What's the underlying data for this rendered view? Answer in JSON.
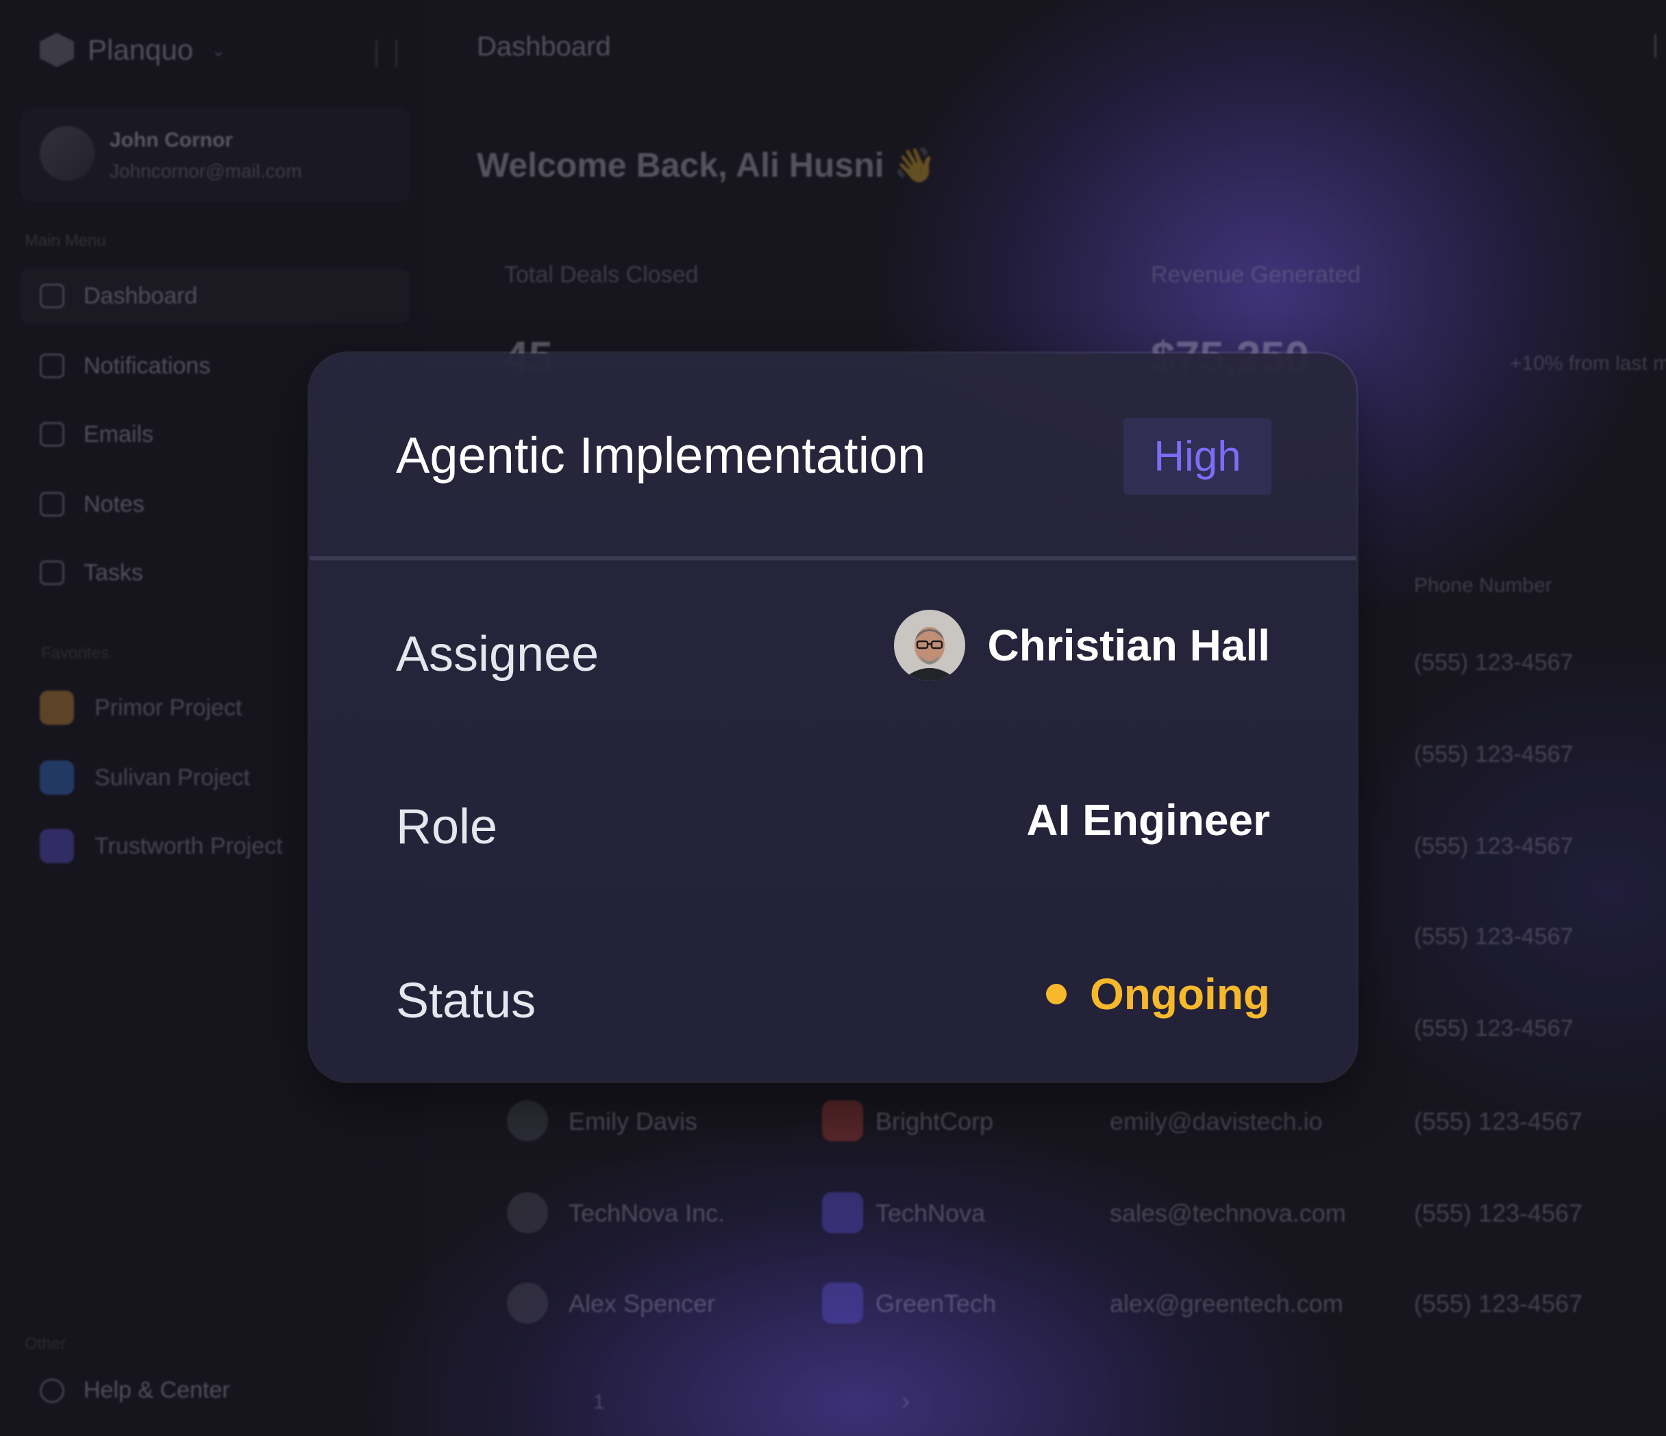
{
  "app": {
    "brand": "Planquo",
    "page_title": "Dashboard",
    "welcome": "Welcome Back, Ali Husni 👋"
  },
  "sidebar": {
    "user": {
      "name": "John Cornor",
      "email": "Johncornor@mail.com"
    },
    "menu_caption": "Main Menu",
    "items": [
      {
        "label": "Dashboard",
        "icon": "grid-icon"
      },
      {
        "label": "Notifications",
        "icon": "bell-icon"
      },
      {
        "label": "Emails",
        "icon": "message-icon"
      },
      {
        "label": "Notes",
        "icon": "note-icon"
      },
      {
        "label": "Tasks",
        "icon": "tasks-icon"
      }
    ],
    "favorites_caption": "Favorites",
    "projects": [
      {
        "label": "Primor Project",
        "color": "#f0a33a"
      },
      {
        "label": "Sulivan Project",
        "color": "#3b82f6"
      },
      {
        "label": "Trustworth Project",
        "color": "#6b5cf6"
      }
    ],
    "other_caption": "Other",
    "help": "Help & Center"
  },
  "stats": {
    "deals_label": "Total Deals Closed",
    "deals_value": "45",
    "revenue_label": "Revenue Generated",
    "revenue_value": "$75,250",
    "revenue_delta": "+10% from last m"
  },
  "table": {
    "phone_header": "Phone Number",
    "phones_above": [
      "(555) 123-4567",
      "(555) 123-4567",
      "(555) 123-4567",
      "(555) 123-4567",
      "(555) 123-4567"
    ],
    "rows": [
      {
        "name": "Emily Davis",
        "company": "BrightCorp",
        "company_color": "#d9493c",
        "email": "emily@davistech.io",
        "phone": "(555) 123-4567"
      },
      {
        "name": "TechNova Inc.",
        "company": "TechNova",
        "company_color": "#6b5cf6",
        "email": "sales@technova.com",
        "phone": "(555) 123-4567"
      },
      {
        "name": "Alex Spencer",
        "company": "GreenTech",
        "company_color": "#6b5cf6",
        "email": "alex@greentech.com",
        "phone": "(555) 123-4567"
      }
    ],
    "pager_page": "1",
    "pager_next": "›"
  },
  "modal": {
    "task_title": "Agentic Implementation",
    "priority": "High",
    "priority_color": "#7c6cf6",
    "assignee_label": "Assignee",
    "assignee_name": "Christian Hall",
    "role_label": "Role",
    "role_value": "AI Engineer",
    "status_label": "Status",
    "status_value": "Ongoing",
    "status_color": "#f7b92b"
  }
}
